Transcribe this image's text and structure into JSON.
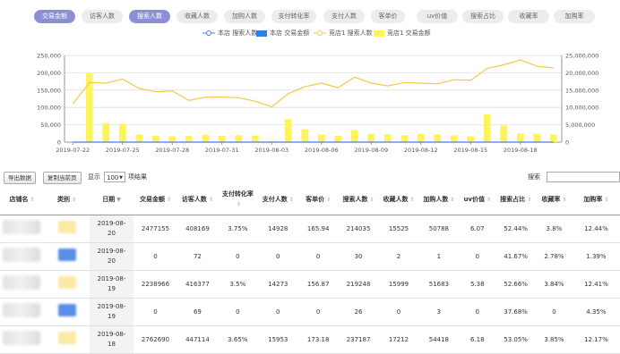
{
  "tabs": [
    {
      "label": "交易金额",
      "active": true
    },
    {
      "label": "访客人数",
      "active": false
    },
    {
      "label": "搜索人数",
      "active": true
    },
    {
      "label": "收藏人数",
      "active": false
    },
    {
      "label": "加购人数",
      "active": false
    },
    {
      "label": "支付转化率",
      "active": false
    },
    {
      "label": "支付人数",
      "active": false
    },
    {
      "label": "客单价",
      "active": false
    },
    {
      "label": "uv价值",
      "active": false
    },
    {
      "label": "搜索占比",
      "active": false
    },
    {
      "label": "收藏率",
      "active": false
    },
    {
      "label": "加购率",
      "active": false
    }
  ],
  "legend": {
    "store_search": "本店 搜索人数",
    "store_trade": "本店 交易金额",
    "competitor_search": "竞店1 搜索人数",
    "competitor_trade": "竞店1 交易金额"
  },
  "colors": {
    "tab_active": "#8d8fd6",
    "line_store": "#4a7fd9",
    "bar_store": "#2d7fe0",
    "line_competitor": "#f2c94c",
    "bar_competitor": "#fdf35a"
  },
  "chart_data": {
    "type": "bar",
    "x_tick_labels": [
      "2019-07-22",
      "2019-07-25",
      "2019-07-28",
      "2019-07-31",
      "2019-08-03",
      "2019-08-06",
      "2019-08-09",
      "2019-08-12",
      "2019-08-15",
      "2019-08-18"
    ],
    "y_left_ticks": [
      "0",
      "50,000",
      "100,000",
      "150,000",
      "200,000",
      "250,000"
    ],
    "y_right_ticks": [
      "0",
      "5,000,000",
      "10,000,000",
      "15,000,000",
      "20,000,000",
      "25,000,000"
    ],
    "ylim_left": [
      0,
      250000
    ],
    "ylim_right": [
      0,
      25000000
    ],
    "series": [
      {
        "name": "竞店1 搜索人数",
        "kind": "line",
        "axis": "left",
        "values": [
          110000,
          172000,
          170000,
          182000,
          155000,
          145000,
          148000,
          120000,
          130000,
          130000,
          128000,
          118000,
          102000,
          140000,
          160000,
          170000,
          157000,
          187000,
          170000,
          162000,
          172000,
          170000,
          168000,
          180000,
          178000,
          213000,
          223000,
          237000,
          219000,
          214000
        ]
      },
      {
        "name": "竞店1 交易金额",
        "kind": "bar",
        "axis": "right",
        "values": [
          0,
          19800000,
          5500000,
          5300000,
          2200000,
          1800000,
          1700000,
          1800000,
          2100000,
          1800000,
          2000000,
          1900000,
          300000,
          6600000,
          3700000,
          2200000,
          1800000,
          3500000,
          2400000,
          2200000,
          2000000,
          2400000,
          2200000,
          2000000,
          1700000,
          8000000,
          4800000,
          2500000,
          2400000,
          2200000
        ]
      },
      {
        "name": "本店 搜索人数",
        "kind": "line",
        "axis": "left",
        "values": [
          0,
          0,
          0,
          0,
          0,
          0,
          0,
          0,
          0,
          0,
          0,
          0,
          0,
          0,
          0,
          0,
          0,
          0,
          0,
          0,
          0,
          0,
          0,
          0,
          0,
          0,
          0,
          0,
          0,
          0
        ]
      },
      {
        "name": "本店 交易金额",
        "kind": "bar",
        "axis": "right",
        "values": [
          0,
          0,
          0,
          0,
          0,
          0,
          0,
          0,
          0,
          0,
          0,
          0,
          0,
          0,
          0,
          0,
          0,
          0,
          0,
          0,
          0,
          0,
          0,
          0,
          0,
          0,
          0,
          0,
          0,
          0
        ]
      }
    ]
  },
  "toolbar": {
    "export_label": "导出数据",
    "copy_label": "复制当前页",
    "show_label": "显示",
    "page_size": "100",
    "page_suffix": "项结果",
    "search_label": "搜索"
  },
  "table": {
    "headers": [
      {
        "label": "店铺名",
        "sort": "both"
      },
      {
        "label": "类别",
        "sort": "both"
      },
      {
        "label": "日期",
        "sort": "desc"
      },
      {
        "label": "交易金额",
        "sort": "both"
      },
      {
        "label": "访客人数",
        "sort": "both"
      },
      {
        "label": "支付转化率",
        "sort": "both"
      },
      {
        "label": "支付人数",
        "sort": "both"
      },
      {
        "label": "客单价",
        "sort": "both"
      },
      {
        "label": "搜索人数",
        "sort": "both"
      },
      {
        "label": "收藏人数",
        "sort": "both"
      },
      {
        "label": "加购人数",
        "sort": "both"
      },
      {
        "label": "uv价值",
        "sort": "both"
      },
      {
        "label": "搜索占比",
        "sort": "both"
      },
      {
        "label": "收藏率",
        "sort": "both"
      },
      {
        "label": "加购率",
        "sort": "both"
      }
    ],
    "rows": [
      {
        "category_color": "#fbe9a6",
        "cells": [
          "2019-08-20",
          "2477155",
          "408169",
          "3.75%",
          "14928",
          "165.94",
          "214035",
          "15525",
          "50788",
          "6.07",
          "52.44%",
          "3.8%",
          "12.44%"
        ]
      },
      {
        "category_color": "#5b8ee6",
        "cells": [
          "2019-08-20",
          "0",
          "72",
          "0",
          "0",
          "0",
          "30",
          "2",
          "1",
          "0",
          "41.67%",
          "2.78%",
          "1.39%"
        ]
      },
      {
        "category_color": "#fbe9a6",
        "cells": [
          "2019-08-19",
          "2238966",
          "416377",
          "3.5%",
          "14273",
          "156.87",
          "219248",
          "15999",
          "51683",
          "5.38",
          "52.66%",
          "3.84%",
          "12.41%"
        ]
      },
      {
        "category_color": "#5b8ee6",
        "cells": [
          "2019-08-19",
          "0",
          "69",
          "0",
          "0",
          "0",
          "26",
          "0",
          "3",
          "0",
          "37.68%",
          "0",
          "4.35%"
        ]
      },
      {
        "category_color": "#fbe9a6",
        "cells": [
          "2019-08-18",
          "2762690",
          "447114",
          "3.65%",
          "15953",
          "173.18",
          "237187",
          "17212",
          "54418",
          "6.18",
          "53.05%",
          "3.85%",
          "12.17%"
        ]
      }
    ]
  }
}
